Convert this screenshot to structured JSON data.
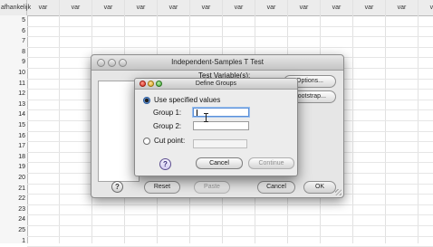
{
  "spreadsheet": {
    "first_header": "afhankelijk",
    "var_label": "var",
    "row_numbers": [
      "5",
      "6",
      "7",
      "8",
      "9",
      "10",
      "11",
      "12",
      "13",
      "14",
      "15",
      "16",
      "17",
      "18",
      "19",
      "20",
      "21",
      "22",
      "23",
      "24",
      "25",
      "1"
    ]
  },
  "main_dialog": {
    "title": "Independent-Samples T Test",
    "test_variables_label": "Test Variable(s):",
    "options_label": "Options...",
    "bootstrap_label": "Bootstrap...",
    "reset_label": "Reset",
    "paste_label": "Paste",
    "cancel_label": "Cancel",
    "ok_label": "OK",
    "help_label": "?"
  },
  "define_groups": {
    "title": "Define Groups",
    "use_specified_label": "Use specified values",
    "group1_label": "Group 1:",
    "group1_value": "",
    "group2_label": "Group 2:",
    "group2_value": "",
    "cut_point_label": "Cut point:",
    "cut_point_value": "",
    "cancel_label": "Cancel",
    "continue_label": "Continue",
    "help_label": "?"
  }
}
